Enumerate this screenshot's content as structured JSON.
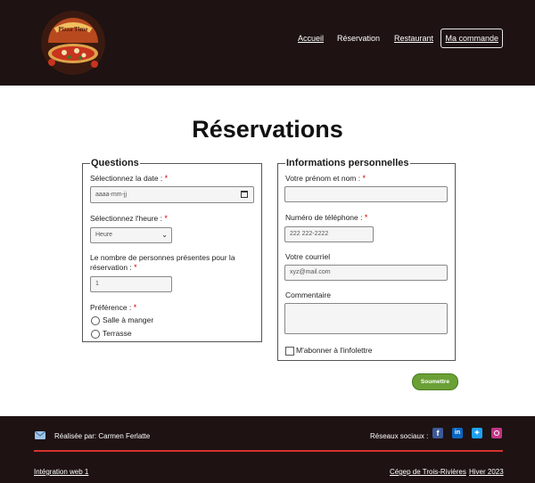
{
  "header": {
    "logo_text": "Pizza Time",
    "nav": [
      {
        "label": "Accueil"
      },
      {
        "label": "Réservation"
      },
      {
        "label": "Restaurant"
      },
      {
        "label": "Ma commande"
      }
    ]
  },
  "page": {
    "title": "Réservations"
  },
  "questions": {
    "legend": "Questions",
    "date_label": "Sélectionnez la date :",
    "date_placeholder": "aaaa-mm-jj",
    "time_label": "Sélectionnez l'heure :",
    "time_value": "Heure",
    "people_label": "Le nombre de personnes présentes pour la réservation :",
    "people_value": "1",
    "preference_label": "Préférence :",
    "preference_options": [
      "Salle à manger",
      "Terrasse"
    ]
  },
  "personal": {
    "legend": "Informations personnelles",
    "name_label": "Votre prénom et nom :",
    "phone_label": "Numéro de téléphone :",
    "phone_placeholder": "222 222-2222",
    "email_label": "Votre courriel",
    "email_placeholder": "xyz@mail.com",
    "comment_label": "Commentaire",
    "newsletter_label": "M'abonner à l'infolettre"
  },
  "required_mark": "*",
  "submit_label": "Soumettre",
  "footer": {
    "author": "Réalisée par: Carmen Ferlatte",
    "social_label": "Réseaux sociaux :",
    "course": "Intégration web 1",
    "school": "Cégep de Trois-Rivières",
    "term": "Hiver 2023"
  },
  "colors": {
    "header_bg": "#1e1212",
    "required": "#cc0000",
    "submit_bg": "#6aa035",
    "footer_rule": "#d4322b",
    "facebook": "#3b5998",
    "linkedin": "#0a66c2",
    "twitter": "#1da1f2",
    "instagram": "#c13584"
  }
}
